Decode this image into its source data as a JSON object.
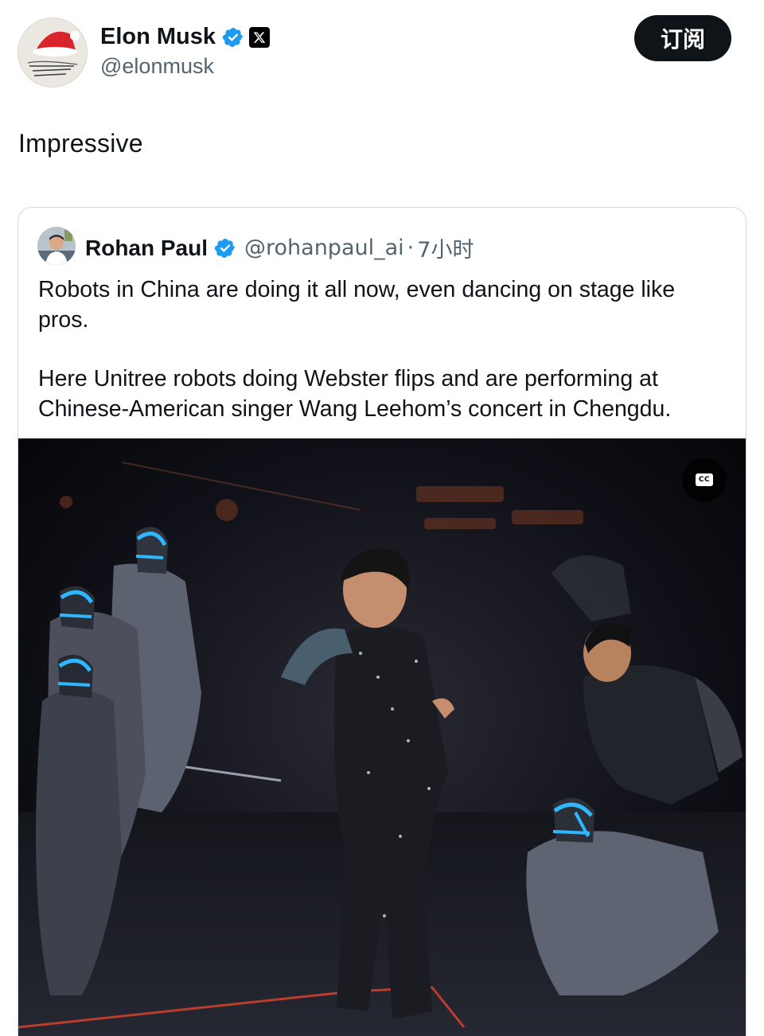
{
  "post": {
    "author": {
      "name": "Elon Musk",
      "handle": "@elonmusk",
      "verified_icon": "verified-badge-icon",
      "affiliate_icon": "x-logo-icon"
    },
    "subscribe_label": "订阅",
    "text": "Impressive"
  },
  "quote": {
    "author": {
      "name": "Rohan Paul",
      "handle": "@rohanpaul_ai",
      "time": "7小时",
      "separator": "·"
    },
    "paragraphs": [
      "Robots in China are doing it all now, even dancing on stage like pros.",
      "Here Unitree robots doing Webster flips and are performing at Chinese-American singer Wang Leehom’s concert in Chengdu."
    ],
    "video": {
      "cc_label": "CC"
    }
  },
  "colors": {
    "text_primary": "#0f1419",
    "text_secondary": "#536471",
    "verified_blue": "#1d9bf0",
    "card_border": "#cfd9de",
    "robot_visor": "#2fb8ff"
  }
}
